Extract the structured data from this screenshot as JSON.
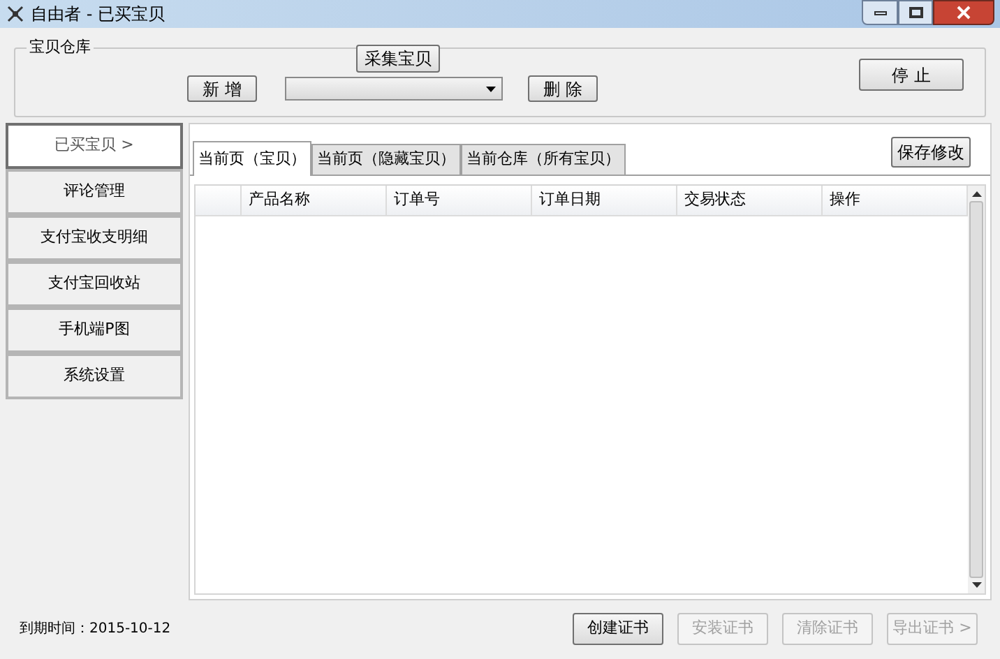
{
  "window": {
    "title": "自由者 - 已买宝贝"
  },
  "group": {
    "title": "宝贝仓库",
    "collect_button": "采集宝贝",
    "add_button": "新 增",
    "delete_button": "删 除",
    "stop_button": "停 止"
  },
  "sidebar": {
    "items": [
      {
        "label": "已买宝贝 >",
        "selected": true
      },
      {
        "label": "评论管理",
        "selected": false
      },
      {
        "label": "支付宝收支明细",
        "selected": false
      },
      {
        "label": "支付宝回收站",
        "selected": false
      },
      {
        "label": "手机端P图",
        "selected": false
      },
      {
        "label": "系统设置",
        "selected": false
      }
    ]
  },
  "tabs": [
    {
      "label": "当前页（宝贝）",
      "selected": true
    },
    {
      "label": "当前页（隐藏宝贝）",
      "selected": false
    },
    {
      "label": "当前仓库（所有宝贝）",
      "selected": false
    }
  ],
  "save_button": "保存修改",
  "table": {
    "columns": [
      "产品名称",
      "订单号",
      "订单日期",
      "交易状态",
      "操作"
    ]
  },
  "status": {
    "expiry": "到期时间：2015-10-12"
  },
  "footer_buttons": [
    {
      "label": "创建证书",
      "disabled": false
    },
    {
      "label": "安装证书",
      "disabled": true
    },
    {
      "label": "清除证书",
      "disabled": true
    },
    {
      "label": "导出证书 >",
      "disabled": true
    }
  ]
}
